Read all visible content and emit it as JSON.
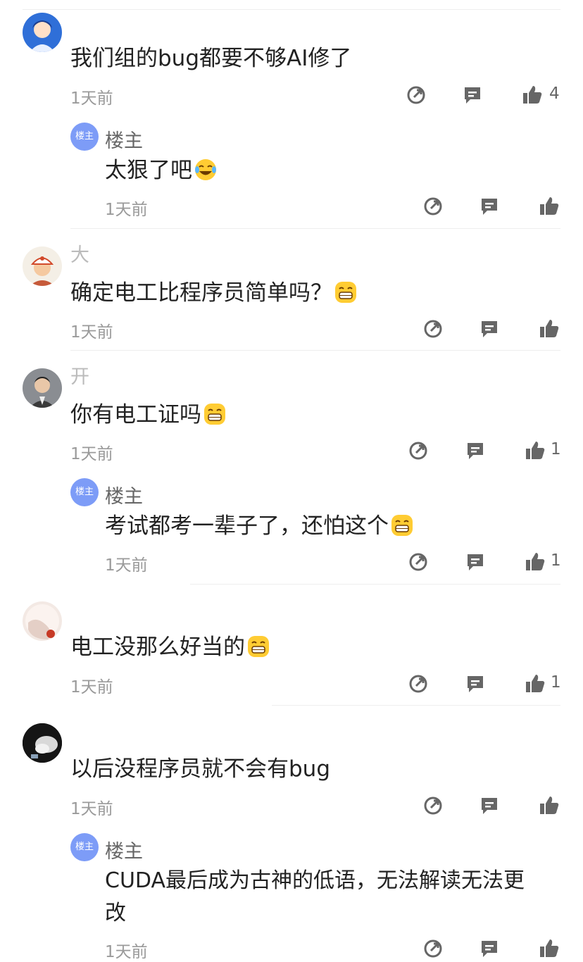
{
  "host_label": "楼主",
  "host_badge": "楼主",
  "comments": [
    {
      "text": "我们组的bug都要不够AI修了",
      "time": "1天前",
      "likes": "4",
      "reply": {
        "text": "太狠了吧",
        "time": "1天前",
        "likes": ""
      }
    },
    {
      "name": "大",
      "text": "确定电工比程序员简单吗？",
      "time": "1天前",
      "likes": ""
    },
    {
      "name": "开",
      "text": "你有电工证吗",
      "time": "1天前",
      "likes": "1",
      "reply": {
        "text": "考试都考一辈子了，还怕这个",
        "time": "1天前",
        "likes": "1"
      }
    },
    {
      "text": "电工没那么好当的",
      "time": "1天前",
      "likes": "1"
    },
    {
      "text": "以后没程序员就不会有bug",
      "time": "1天前",
      "likes": "",
      "reply": {
        "text": "CUDA最后成为古神的低语，无法解读无法更",
        "text2": "改",
        "time": "1天前",
        "likes": ""
      }
    }
  ]
}
